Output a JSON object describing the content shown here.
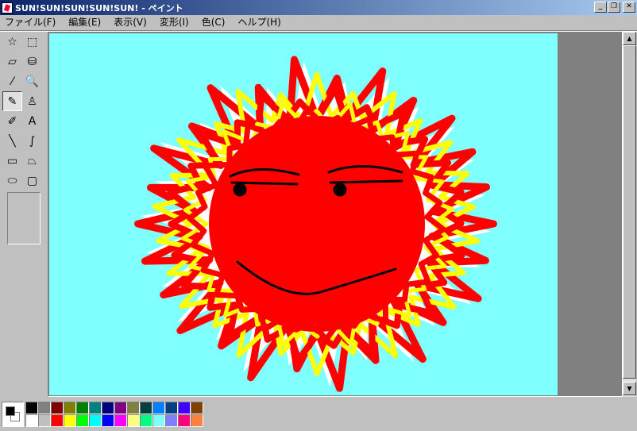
{
  "window": {
    "title": "SUN!SUN!SUN!SUN!SUN! - ペイント",
    "buttons": [
      "_",
      "❐",
      "✕"
    ]
  },
  "menu": [
    {
      "label": "ファイル(F)"
    },
    {
      "label": "編集(E)"
    },
    {
      "label": "表示(V)"
    },
    {
      "label": "変形(I)"
    },
    {
      "label": "色(C)"
    },
    {
      "label": "ヘルプ(H)"
    }
  ],
  "tools": [
    {
      "name": "free-select-icon",
      "glyph": "☆"
    },
    {
      "name": "rect-select-icon",
      "glyph": "⬚"
    },
    {
      "name": "eraser-icon",
      "glyph": "▱"
    },
    {
      "name": "fill-bucket-icon",
      "glyph": "⛁"
    },
    {
      "name": "color-picker-icon",
      "glyph": "⁄"
    },
    {
      "name": "magnifier-icon",
      "glyph": "🔍"
    },
    {
      "name": "pencil-icon",
      "glyph": "✎",
      "selected": true
    },
    {
      "name": "brush-icon",
      "glyph": "♙"
    },
    {
      "name": "airbrush-icon",
      "glyph": "✐"
    },
    {
      "name": "text-icon",
      "glyph": "A"
    },
    {
      "name": "line-icon",
      "glyph": "╲"
    },
    {
      "name": "curve-icon",
      "glyph": "∫"
    },
    {
      "name": "rectangle-icon",
      "glyph": "▭"
    },
    {
      "name": "polygon-icon",
      "glyph": "⏢"
    },
    {
      "name": "ellipse-icon",
      "glyph": "⬭"
    },
    {
      "name": "rounded-rect-icon",
      "glyph": "▢"
    }
  ],
  "colors": {
    "canvas_bg": "#80ffff",
    "sun_red": "#ff0000",
    "flame_yellow": "#ffff00",
    "flame_white": "#ffffff",
    "face_black": "#000000"
  },
  "palette": {
    "foreground": "#000000",
    "background": "#ffffff",
    "swatches": [
      "#000000",
      "#808080",
      "#800000",
      "#808000",
      "#008000",
      "#008080",
      "#000080",
      "#800080",
      "#808040",
      "#004040",
      "#0080ff",
      "#004080",
      "#4000ff",
      "#804000",
      "#ffffff",
      "#c0c0c0",
      "#ff0000",
      "#ffff00",
      "#00ff00",
      "#00ffff",
      "#0000ff",
      "#ff00ff",
      "#ffff80",
      "#00ff80",
      "#80ffff",
      "#8080ff",
      "#ff0080",
      "#ff8040"
    ]
  }
}
